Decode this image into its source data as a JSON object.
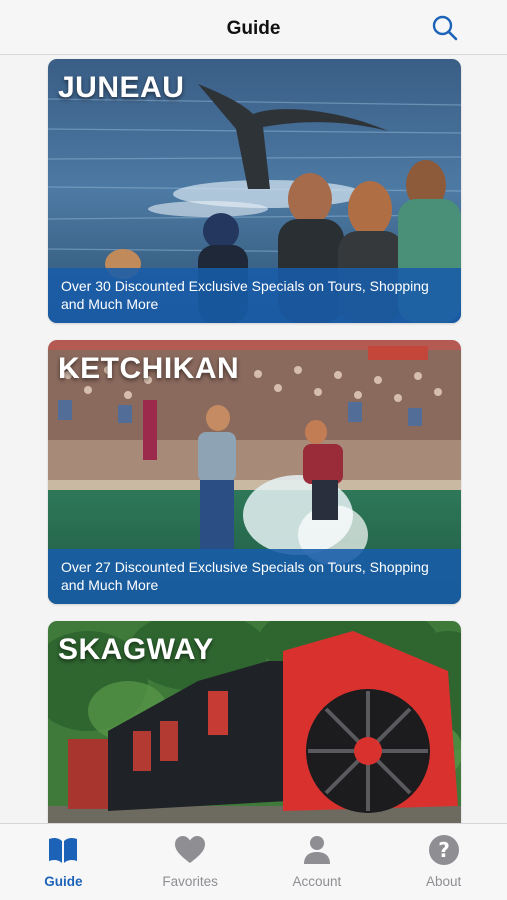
{
  "header": {
    "title": "Guide",
    "search_icon": "search-icon"
  },
  "cards": [
    {
      "city": "JUNEAU",
      "caption": "Over 30 Discounted Exclusive Specials on Tours, Shopping and Much More",
      "photo": "whale-watching-photo"
    },
    {
      "city": "KETCHIKAN",
      "caption": "Over 27 Discounted Exclusive Specials on Tours, Shopping and Much More",
      "photo": "lumberjack-show-photo"
    },
    {
      "city": "SKAGWAY",
      "photo": "railway-rotary-snowplow-photo"
    }
  ],
  "tabs": [
    {
      "label": "Guide",
      "icon": "book-icon",
      "active": true
    },
    {
      "label": "Favorites",
      "icon": "heart-icon",
      "active": false
    },
    {
      "label": "Account",
      "icon": "person-icon",
      "active": false
    },
    {
      "label": "About",
      "icon": "question-icon",
      "active": false
    }
  ],
  "colors": {
    "accent": "#1c63b8",
    "caption_bg": "#185caa",
    "inactive": "#8e8e93"
  }
}
